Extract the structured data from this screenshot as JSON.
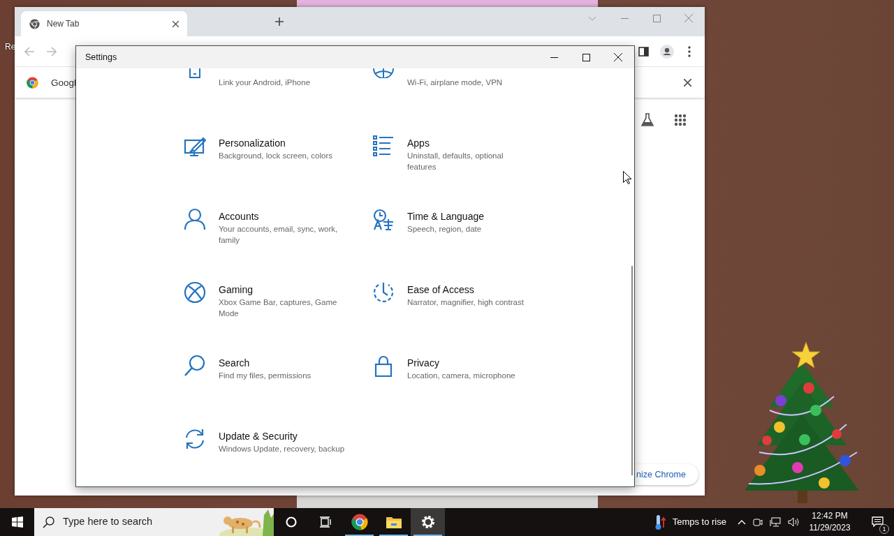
{
  "desktop": {
    "icon_label": "Re"
  },
  "browser": {
    "tabs": [
      {
        "label": "New Tab",
        "selected": true
      }
    ],
    "bookmark_bar": {
      "item": "Googl"
    },
    "customize_button": "nize Chrome"
  },
  "settings": {
    "title": "Settings",
    "items": [
      {
        "kind": "phone",
        "description": "Link your Android, iPhone"
      },
      {
        "kind": "globe",
        "description": "Wi-Fi, airplane mode, VPN"
      },
      {
        "kind": "brush",
        "title": "Personalization",
        "description": "Background, lock screen, colors"
      },
      {
        "kind": "apps",
        "title": "Apps",
        "description": "Uninstall, defaults, optional features"
      },
      {
        "kind": "person",
        "title": "Accounts",
        "description": "Your accounts, email, sync, work, family"
      },
      {
        "kind": "time",
        "title": "Time & Language",
        "description": "Speech, region, date"
      },
      {
        "kind": "xbox",
        "title": "Gaming",
        "description": "Xbox Game Bar, captures, Game Mode"
      },
      {
        "kind": "ease",
        "title": "Ease of Access",
        "description": "Narrator, magnifier, high contrast"
      },
      {
        "kind": "search",
        "title": "Search",
        "description": "Find my files, permissions"
      },
      {
        "kind": "lock",
        "title": "Privacy",
        "description": "Location, camera, microphone"
      },
      {
        "kind": "update",
        "title": "Update & Security",
        "description": "Windows Update, recovery, backup"
      }
    ]
  },
  "taskbar": {
    "search_placeholder": "Type here to search",
    "apps": [
      {
        "kind": "chrome",
        "running": true,
        "selected": false
      },
      {
        "kind": "explorer",
        "running": true,
        "selected": false
      },
      {
        "kind": "settings",
        "running": true,
        "selected": true
      }
    ],
    "weather": "Temps to rise",
    "time": "12:42 PM",
    "date": "11/29/2023",
    "notification_count": "1"
  }
}
